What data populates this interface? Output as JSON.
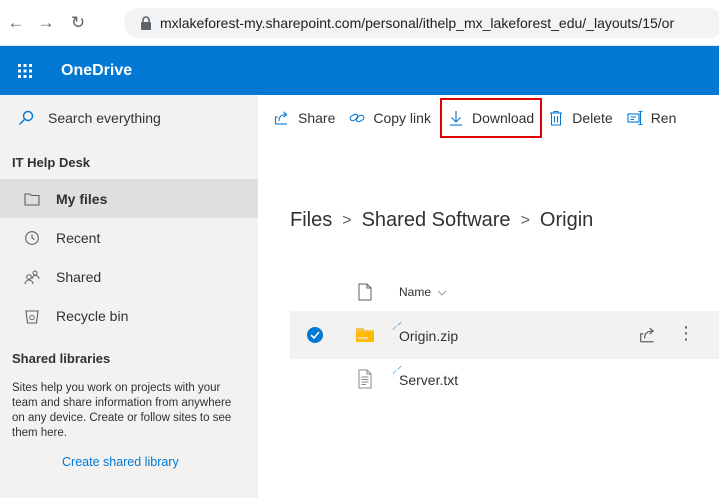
{
  "browser": {
    "url": "mxlakeforest-my.sharepoint.com/personal/ithelp_mx_lakeforest_edu/_layouts/15/or"
  },
  "header": {
    "app_name": "OneDrive"
  },
  "sidebar": {
    "search_placeholder": "Search everything",
    "section_title": "IT Help Desk",
    "items": [
      {
        "label": "My files",
        "icon": "folder-icon",
        "selected": true
      },
      {
        "label": "Recent",
        "icon": "clock-icon",
        "selected": false
      },
      {
        "label": "Shared",
        "icon": "people-icon",
        "selected": false
      },
      {
        "label": "Recycle bin",
        "icon": "recycle-bin-icon",
        "selected": false
      }
    ],
    "shared_libraries_title": "Shared libraries",
    "shared_libraries_desc": "Sites help you work on projects with your team and share information from anywhere on any device. Create or follow sites to see them here.",
    "create_library_label": "Create shared library"
  },
  "toolbar": {
    "share_label": "Share",
    "copy_link_label": "Copy link",
    "download_label": "Download",
    "delete_label": "Delete",
    "rename_label": "Ren"
  },
  "breadcrumb": {
    "items": [
      "Files",
      "Shared Software",
      "Origin"
    ]
  },
  "file_list": {
    "name_header": "Name",
    "rows": [
      {
        "name": "Origin.zip",
        "type": "zip",
        "selected": true
      },
      {
        "name": "Server.txt",
        "type": "txt",
        "selected": false
      }
    ]
  },
  "colors": {
    "brand": "#0078d4",
    "highlight_border": "#e00000",
    "nav_bg": "#f3f2f1"
  }
}
